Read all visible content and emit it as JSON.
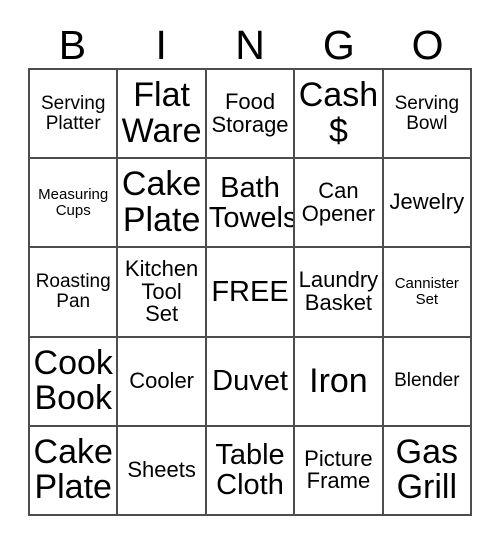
{
  "header": {
    "letters": [
      "B",
      "I",
      "N",
      "G",
      "O"
    ]
  },
  "colors": {
    "grid_line": "#4d4d4d",
    "text": "#000000",
    "background": "#ffffff"
  },
  "grid": {
    "rows": [
      [
        {
          "text": "Serving\nPlatter",
          "size": "sm"
        },
        {
          "text": "Flat\nWare",
          "size": "xl"
        },
        {
          "text": "Food\nStorage",
          "size": "md"
        },
        {
          "text": "Cash\n$",
          "size": "xl"
        },
        {
          "text": "Serving\nBowl",
          "size": "sm"
        }
      ],
      [
        {
          "text": "Measuring\nCups",
          "size": "xs"
        },
        {
          "text": "Cake\nPlate",
          "size": "xl"
        },
        {
          "text": "Bath\nTowels",
          "size": "lg"
        },
        {
          "text": "Can\nOpener",
          "size": "md"
        },
        {
          "text": "Jewelry",
          "size": "md"
        }
      ],
      [
        {
          "text": "Roasting\nPan",
          "size": "sm"
        },
        {
          "text": "Kitchen\nTool\nSet",
          "size": "md"
        },
        {
          "text": "FREE",
          "size": "lg"
        },
        {
          "text": "Laundry\nBasket",
          "size": "md"
        },
        {
          "text": "Cannister\nSet",
          "size": "xs"
        }
      ],
      [
        {
          "text": "Cook\nBook",
          "size": "xl"
        },
        {
          "text": "Cooler",
          "size": "md"
        },
        {
          "text": "Duvet",
          "size": "lg"
        },
        {
          "text": "Iron",
          "size": "xl"
        },
        {
          "text": "Blender",
          "size": "sm"
        }
      ],
      [
        {
          "text": "Cake\nPlate",
          "size": "xl"
        },
        {
          "text": "Sheets",
          "size": "md"
        },
        {
          "text": "Table\nCloth",
          "size": "lg"
        },
        {
          "text": "Picture\nFrame",
          "size": "md"
        },
        {
          "text": "Gas\nGrill",
          "size": "xl"
        }
      ]
    ]
  }
}
